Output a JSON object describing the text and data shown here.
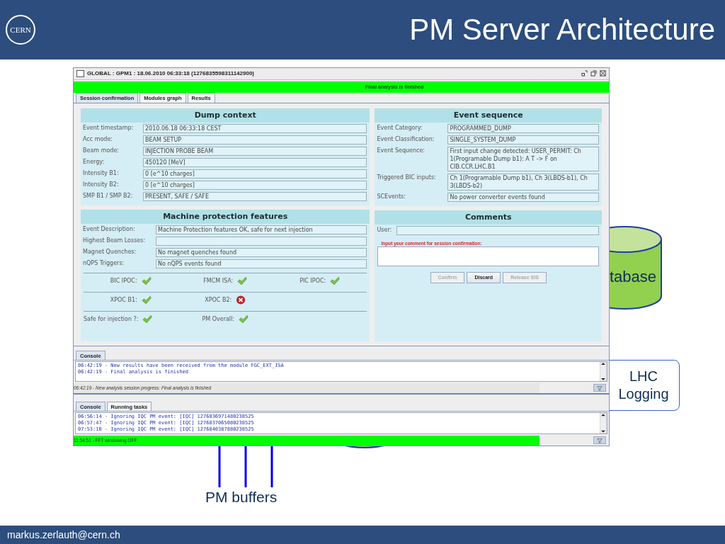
{
  "slide": {
    "logo_text": "CERN",
    "title": "PM Server Architecture",
    "footer": "markus.zerlauth@cern.ch"
  },
  "diagram": {
    "database_label": "tabase",
    "logging_lines": [
      "LHC",
      "Logging"
    ],
    "buffers_label": "PM buffers"
  },
  "window": {
    "title": "GLOBAL : GPM1 : 18.06.2010 06:33:18 (1276835598311142900)",
    "banner": "Final analysis is finished",
    "tabs": [
      {
        "label": "Session confirmation",
        "selected": true
      },
      {
        "label": "Modules graph",
        "selected": false
      },
      {
        "label": "Results",
        "selected": false
      }
    ],
    "dump_context": {
      "title": "Dump context",
      "fields": [
        {
          "label": "Event timestamp:",
          "value": "2010.06.18 06:33:18 CEST"
        },
        {
          "label": "Acc mode:",
          "value": "BEAM SETUP"
        },
        {
          "label": "Beam mode:",
          "value": "INJECTION PROBE BEAM"
        },
        {
          "label": "Energy:",
          "value": "450120 [MeV]"
        },
        {
          "label": "Intensity B1:",
          "value": "0 [e^10 charges]"
        },
        {
          "label": "Intensity B2:",
          "value": "0 [e^10 charges]"
        },
        {
          "label": "SMP B1 / SMP B2:",
          "value": "PRESENT, SAFE / SAFE"
        }
      ]
    },
    "protection": {
      "title": "Machine protection features",
      "fields": [
        {
          "label": "Event Description:",
          "value": "Machine Protection features OK, safe for next injection"
        },
        {
          "label": "Highest Beam Losses:"
        },
        {
          "label": "Magnet Quenches:",
          "value": "No magnet quenches found"
        },
        {
          "label": "nQPS Triggers:",
          "value": "No nQPS events found"
        }
      ],
      "check_rows": [
        [
          {
            "label": "BIC IPOC:",
            "ok": true
          },
          {
            "label": "FMCM ISA:",
            "ok": true
          },
          {
            "label": "PIC IPOC:",
            "ok": true
          }
        ],
        [
          {
            "label": "XPOC B1:",
            "ok": true
          },
          {
            "label": "XPOC B2:",
            "ok": false
          }
        ],
        [
          {
            "label": "Safe for injection ?:",
            "ok": true
          },
          {
            "label": "PM Overall:",
            "ok": true
          }
        ]
      ]
    },
    "event_sequence": {
      "title": "Event sequence",
      "fields": [
        {
          "label": "Event Category:",
          "value": "PROGRAMMED_DUMP"
        },
        {
          "label": "Event Classification:",
          "value": "SINGLE_SYSTEM_DUMP"
        },
        {
          "label": "Event Sequence:",
          "value": "First input change detected: USER_PERMIT: Ch 1(Programable Dump b1): A T -> F on CIB.CCR.LHC.B1"
        },
        {
          "label": "Triggered BIC inputs:",
          "value": "Ch 1(Programable Dump b1),  Ch 3(LBDS-b1), Ch 3(LBDS-b2)"
        },
        {
          "label": "SCEvents:",
          "value": "No power converter events found"
        }
      ]
    },
    "comments": {
      "title": "Comments",
      "user_label": "User:",
      "prompt": "Input your comment for session confirmation:",
      "buttons": [
        {
          "label": "Confirm",
          "disabled": true
        },
        {
          "label": "Discard",
          "disabled": false
        },
        {
          "label": "Release SIS",
          "disabled": true
        }
      ]
    }
  },
  "consoles": [
    {
      "tabs": [
        {
          "label": "Console",
          "selected": true
        }
      ],
      "lines": [
        "06:42:19 - New results have been received from the module FGC_EXT_ISA",
        "06:42:19 - Final analysis is finished"
      ],
      "status": "06:42:19 - New analysis session progress: Final analysis is finished",
      "highlighted": false
    },
    {
      "tabs": [
        {
          "label": "Console",
          "selected": true
        },
        {
          "label": "Running tasks",
          "selected": false
        }
      ],
      "lines": [
        "06:56:14 - Ignoring IQC PM event: [IQC] 1276836971480238525",
        "06:57:47 - Ignoring IQC PM event: [IQC] 1276837065080238525",
        "07:53:10 - Ignoring IQC PM event: [IQC] 1276840387880238525"
      ],
      "status": "11:54:51 - FFT windowing OFF",
      "highlighted": true
    }
  ]
}
